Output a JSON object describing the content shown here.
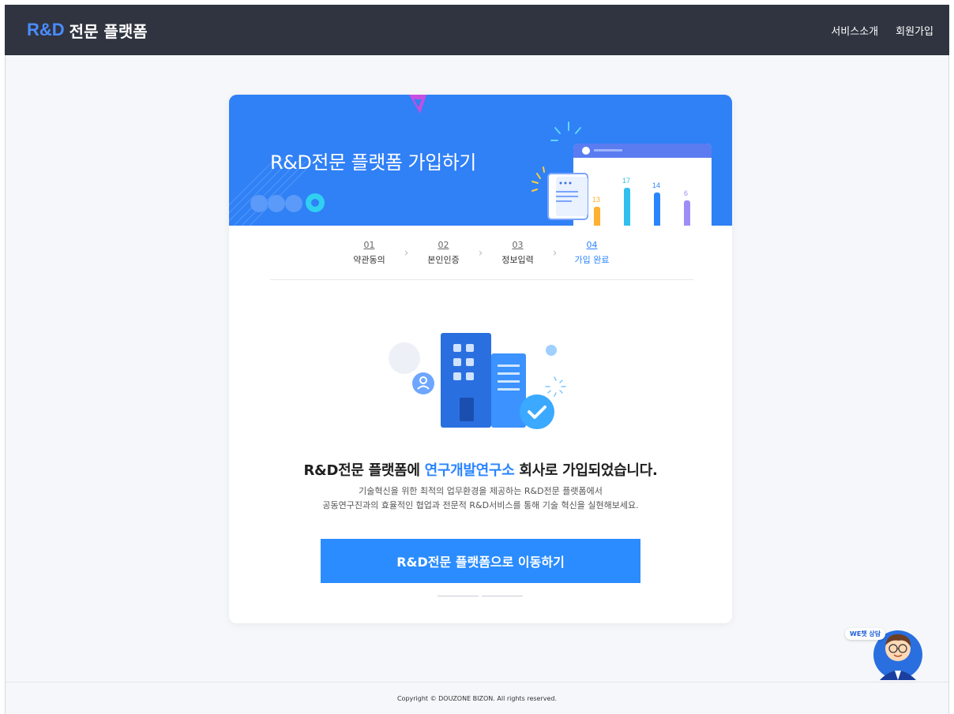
{
  "header": {
    "logo_rd": "R&D",
    "logo_text": "전문 플랫폼",
    "nav": [
      "서비스소개",
      "회원가입"
    ]
  },
  "banner": {
    "title": "R&D전문 플랫폼 가입하기",
    "chart_values": [
      "13",
      "17",
      "14",
      "6"
    ]
  },
  "steps": [
    {
      "num": "01",
      "label": "약관동의"
    },
    {
      "num": "02",
      "label": "본인인증"
    },
    {
      "num": "03",
      "label": "정보입력"
    },
    {
      "num": "04",
      "label": "가입 완료"
    }
  ],
  "active_step": "04",
  "result": {
    "headline_prefix": "R&D전문 플랫폼에 ",
    "headline_highlight": "연구개발연구소",
    "headline_suffix": " 회사로 가입되었습니다.",
    "desc_line1": "기술혁신을 위한 최적의 업무환경을 제공하는 R&D전문 플랫폼에서",
    "desc_line2": "공동연구진과의 효율적인 협업과 전문적 R&D서비스를 통해 기술 혁신을 실현해보세요."
  },
  "cta_label": "R&D전문 플랫폼으로 이동하기",
  "footer": {
    "copyright": "Copyright © DOUZONE BIZON. All rights reserved."
  },
  "chatbot": {
    "label": "WE챗 상담"
  },
  "colors": {
    "topbar": "#2f3440",
    "accent": "#2a8cff",
    "banner": "#3080f6"
  }
}
